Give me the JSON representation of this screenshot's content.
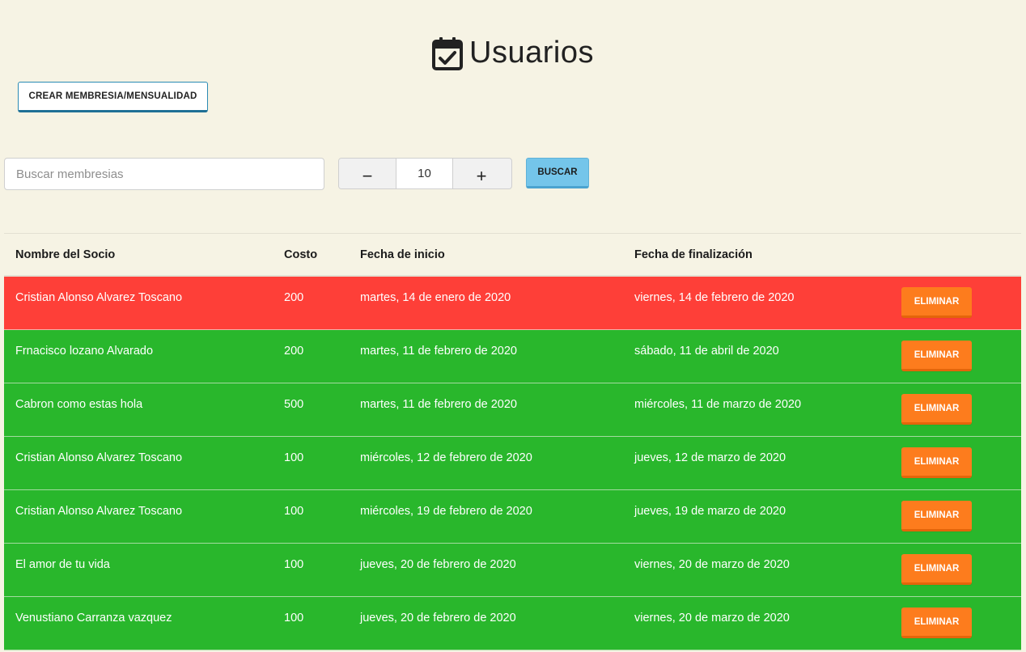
{
  "header": {
    "title": "Usuarios",
    "icon": "calendar-check-icon"
  },
  "toolbar": {
    "create_label": "CREAR MEMBRESIA/MENSUALIDAD"
  },
  "search": {
    "placeholder": "Buscar membresias",
    "value": "",
    "stepper": {
      "minus": "−",
      "value": "10",
      "plus": "+"
    },
    "button_label": "BUSCAR"
  },
  "table": {
    "columns": [
      "Nombre del Socio",
      "Costo",
      "Fecha de inicio",
      "Fecha de finalización"
    ],
    "delete_label": "ELIMINAR",
    "rows": [
      {
        "name": "Cristian Alonso Alvarez Toscano",
        "cost": "200",
        "start": "martes, 14 de enero de 2020",
        "end": "viernes, 14 de febrero de 2020",
        "status": "expired",
        "color": "#fe3f38"
      },
      {
        "name": "Frnacisco lozano Alvarado",
        "cost": "200",
        "start": "martes, 11 de febrero de 2020",
        "end": "sábado, 11 de abril de 2020",
        "status": "active",
        "color": "#29b72c"
      },
      {
        "name": "Cabron como estas hola",
        "cost": "500",
        "start": "martes, 11 de febrero de 2020",
        "end": "miércoles, 11 de marzo de 2020",
        "status": "active",
        "color": "#29b72c"
      },
      {
        "name": "Cristian Alonso Alvarez Toscano",
        "cost": "100",
        "start": "miércoles, 12 de febrero de 2020",
        "end": "jueves, 12 de marzo de 2020",
        "status": "active",
        "color": "#29b72c"
      },
      {
        "name": "Cristian Alonso Alvarez Toscano",
        "cost": "100",
        "start": "miércoles, 19 de febrero de 2020",
        "end": "jueves, 19 de marzo de 2020",
        "status": "active",
        "color": "#29b72c"
      },
      {
        "name": "El amor de tu vida",
        "cost": "100",
        "start": "jueves, 20 de febrero de 2020",
        "end": "viernes, 20 de marzo de 2020",
        "status": "active",
        "color": "#29b72c"
      },
      {
        "name": "Venustiano Carranza vazquez",
        "cost": "100",
        "start": "jueves, 20 de febrero de 2020",
        "end": "viernes, 20 de marzo de 2020",
        "status": "active",
        "color": "#29b72c"
      }
    ]
  },
  "colors": {
    "background": "#f6f3e4",
    "expired_row": "#fe3f38",
    "active_row": "#29b72c",
    "delete_button": "#fd7c1d",
    "search_button": "#74c5ea",
    "create_button_border": "#2a8ab3"
  }
}
